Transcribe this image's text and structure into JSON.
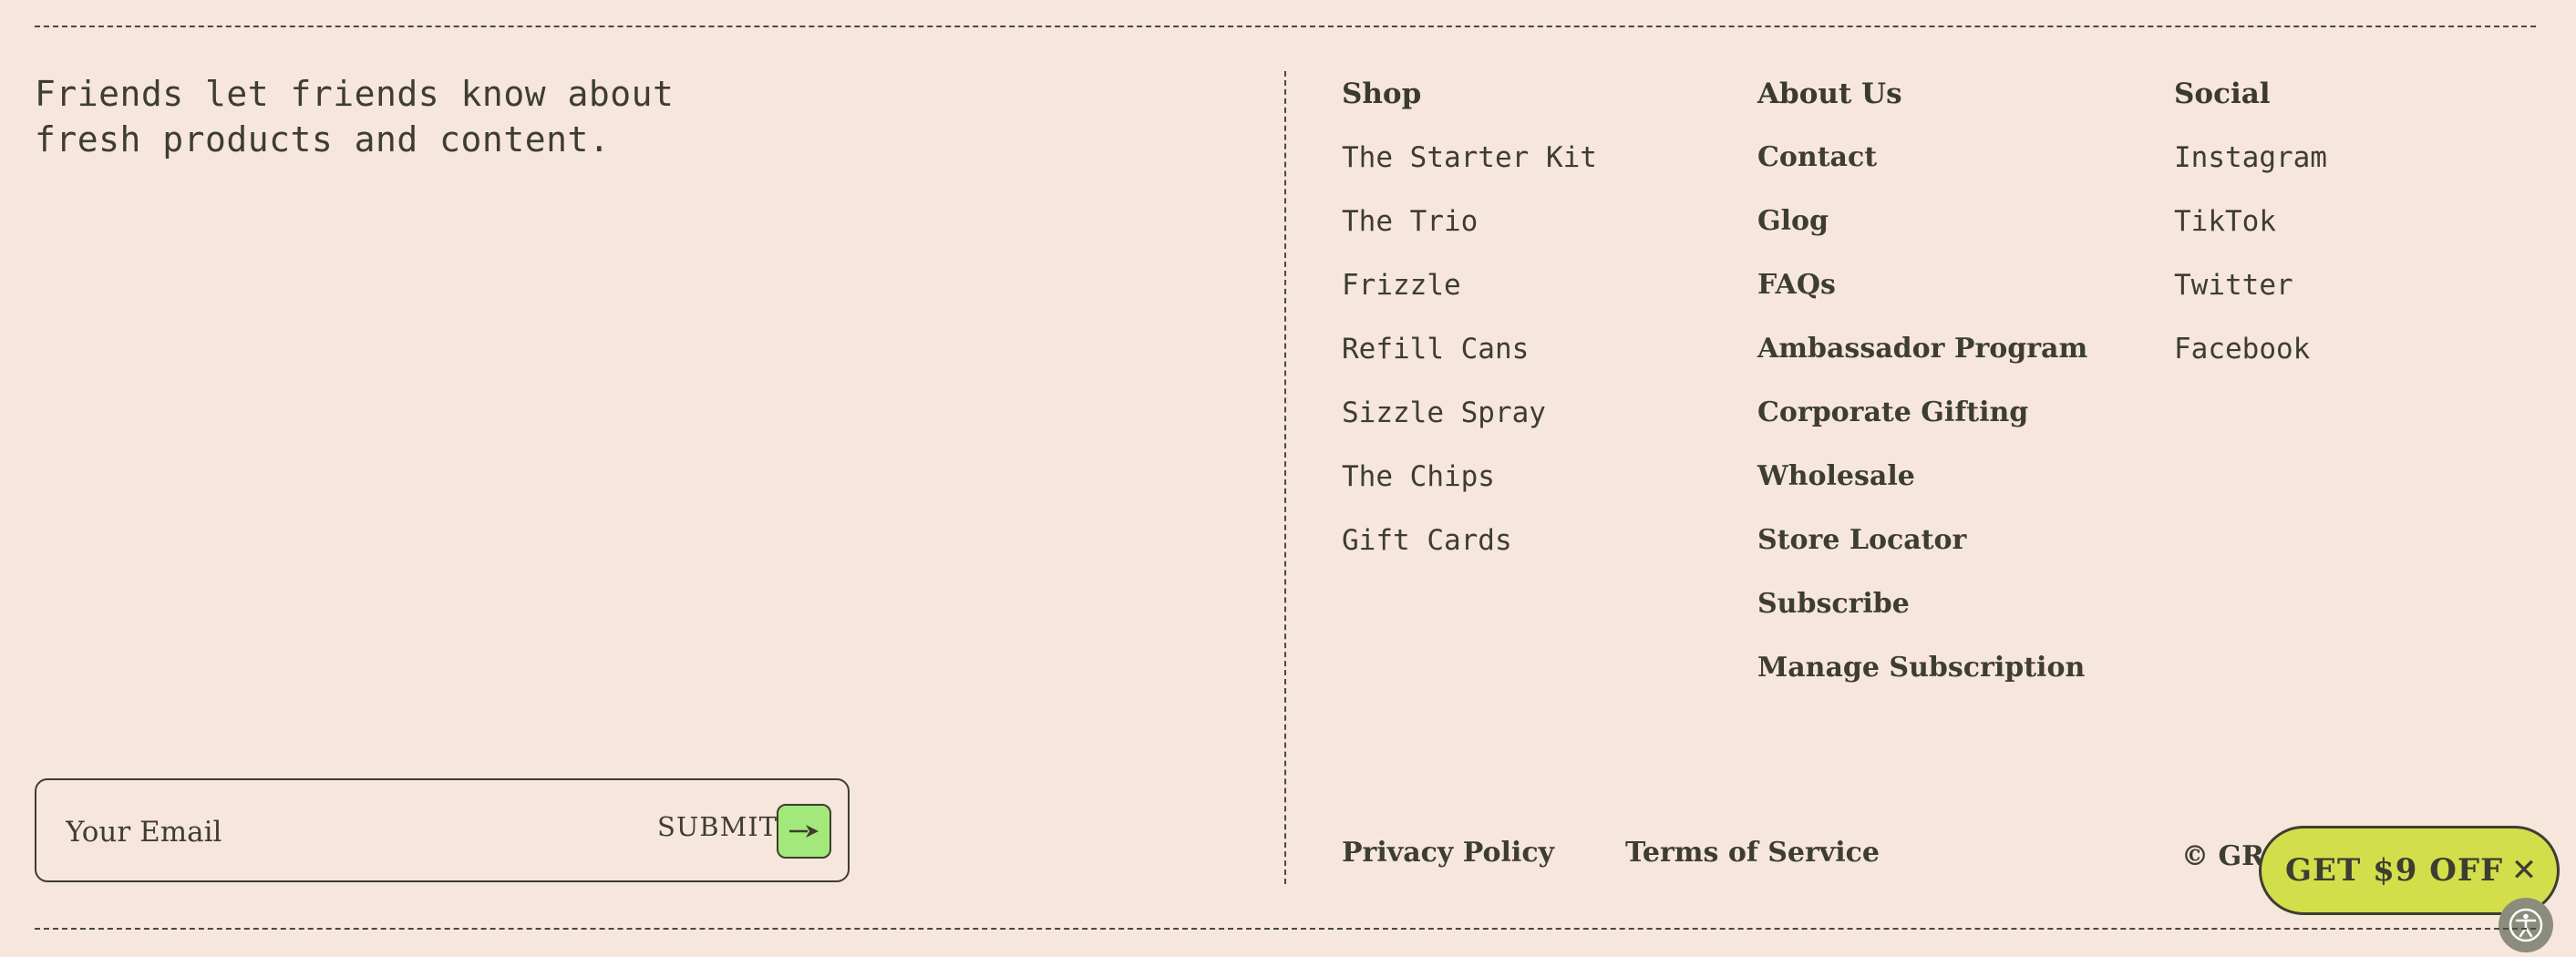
{
  "tagline": {
    "line1": "Friends let friends know about",
    "line2": "fresh products and content."
  },
  "newsletter": {
    "email_placeholder": "Your Email",
    "submit_label": "SUBMIT",
    "submit_icon": "arrow-right-icon"
  },
  "columns": {
    "shop": {
      "heading": "Shop",
      "items": [
        "The Starter Kit",
        "The Trio",
        "Frizzle",
        "Refill Cans",
        "Sizzle Spray",
        "The Chips",
        "Gift Cards"
      ]
    },
    "about": {
      "heading": "About Us",
      "items": [
        "Contact",
        "Glog",
        "FAQs",
        "Ambassador Program",
        "Corporate Gifting",
        "Wholesale",
        "Store Locator",
        "Subscribe",
        "Manage Subscription"
      ]
    },
    "social": {
      "heading": "Social",
      "items": [
        "Instagram",
        "TikTok",
        "Twitter",
        "Facebook"
      ]
    }
  },
  "legal": {
    "privacy": "Privacy Policy",
    "terms": "Terms of Service",
    "copyright": "© GRA"
  },
  "promo": {
    "label": "GET $9 OFF",
    "close": "✕"
  },
  "accessibility": {
    "icon": "accessibility-icon"
  },
  "colors": {
    "background": "#f7e6dc",
    "text": "#3d3d31",
    "submit_green": "#a3e87a",
    "promo_yellow": "#d3df4a"
  }
}
